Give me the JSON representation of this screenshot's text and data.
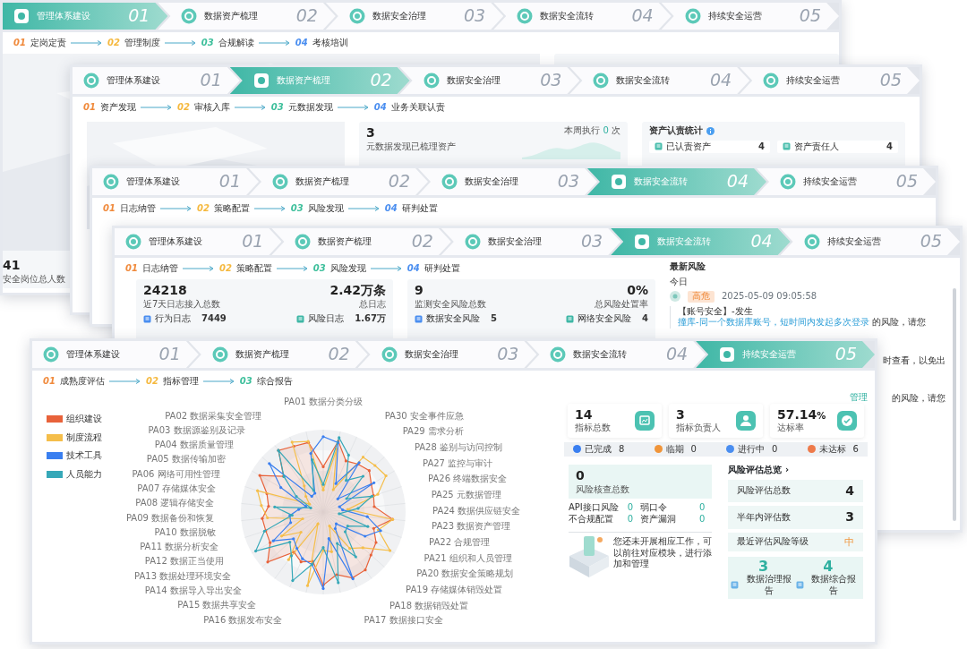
{
  "windows": [
    {
      "kind": "staff",
      "steps": [
        {
          "label": "管理体系建设",
          "number": "01",
          "selected": true
        },
        {
          "label": "数据资产梳理",
          "number": "02",
          "selected": false
        },
        {
          "label": "数据安全治理",
          "number": "03",
          "selected": false
        },
        {
          "label": "数据安全流转",
          "number": "04",
          "selected": false
        },
        {
          "label": "持续安全运营",
          "number": "05",
          "selected": false
        }
      ],
      "breadcrumb": [
        {
          "number": "01",
          "label": "定岗定责",
          "color": "#f08a3c"
        },
        {
          "number": "02",
          "label": "管理制度",
          "color": "#f5b83d"
        },
        {
          "number": "03",
          "label": "合规解读",
          "color": "#3dbf9b"
        },
        {
          "number": "04",
          "label": "考核培训",
          "color": "#4a8ef0"
        }
      ],
      "stat": {
        "value": "41",
        "label": "安全岗位总人数"
      }
    },
    {
      "kind": "assets",
      "steps": [
        {
          "label": "管理体系建设",
          "number": "01",
          "selected": false
        },
        {
          "label": "数据资产梳理",
          "number": "02",
          "selected": true
        },
        {
          "label": "数据安全治理",
          "number": "03",
          "selected": false
        },
        {
          "label": "数据安全流转",
          "number": "04",
          "selected": false
        },
        {
          "label": "持续安全运营",
          "number": "05",
          "selected": false
        }
      ],
      "breadcrumb": [
        {
          "number": "01",
          "label": "资产发现",
          "color": "#f08a3c"
        },
        {
          "number": "02",
          "label": "审核入库",
          "color": "#f5b83d"
        },
        {
          "number": "03",
          "label": "元数据发现",
          "color": "#3dbf9b"
        },
        {
          "number": "04",
          "label": "业务关联认责",
          "color": "#4a8ef0"
        }
      ],
      "discovery": {
        "value": "3",
        "label": "元数据发现已梳理资产",
        "run_label": "本周执行",
        "run_count": "0",
        "run_unit": "次"
      },
      "ownership": {
        "title": "资产认责统计",
        "items": [
          {
            "label": "已认责资产",
            "value": "4"
          },
          {
            "label": "资产责任人",
            "value": "4"
          }
        ]
      }
    },
    {
      "kind": "plain",
      "steps": [
        {
          "label": "管理体系建设",
          "number": "01",
          "selected": false
        },
        {
          "label": "数据资产梳理",
          "number": "02",
          "selected": false
        },
        {
          "label": "数据安全治理",
          "number": "03",
          "selected": false
        },
        {
          "label": "数据安全流转",
          "number": "04",
          "selected": true
        },
        {
          "label": "持续安全运营",
          "number": "05",
          "selected": false
        }
      ],
      "breadcrumb": [
        {
          "number": "01",
          "label": "日志纳管",
          "color": "#f08a3c"
        },
        {
          "number": "02",
          "label": "策略配置",
          "color": "#f5b83d"
        },
        {
          "number": "03",
          "label": "风险发现",
          "color": "#3dbf9b"
        },
        {
          "number": "04",
          "label": "研判处置",
          "color": "#4a8ef0"
        }
      ]
    },
    {
      "kind": "risk",
      "steps": [
        {
          "label": "管理体系建设",
          "number": "01",
          "selected": false
        },
        {
          "label": "数据资产梳理",
          "number": "02",
          "selected": false
        },
        {
          "label": "数据安全治理",
          "number": "03",
          "selected": false
        },
        {
          "label": "数据安全流转",
          "number": "04",
          "selected": true
        },
        {
          "label": "持续安全运营",
          "number": "05",
          "selected": false
        }
      ],
      "breadcrumb": [
        {
          "number": "01",
          "label": "日志纳管",
          "color": "#f08a3c"
        },
        {
          "number": "02",
          "label": "策略配置",
          "color": "#f5b83d"
        },
        {
          "number": "03",
          "label": "风险发现",
          "color": "#3dbf9b"
        },
        {
          "number": "04",
          "label": "研判处置",
          "color": "#4a8ef0"
        }
      ],
      "cards": [
        {
          "value": "24218",
          "label": "近7天日志接入总数",
          "value2": "2.42万条",
          "label2": "总日志",
          "items": [
            {
              "label": "行为日志",
              "value": "7449"
            },
            {
              "label": "风险日志",
              "value": "1.67万"
            }
          ]
        },
        {
          "value": "9",
          "label": "监测安全风险总数",
          "value2": "0%",
          "label2": "总风险处置率",
          "items": [
            {
              "label": "数据安全风险",
              "value": "5"
            },
            {
              "label": "网络安全风险",
              "value": "4"
            }
          ]
        }
      ],
      "latest": {
        "title": "最新风险",
        "day": "今日",
        "level": "高危",
        "time": "2025-05-09 09:05:58",
        "prefix": "【账号安全】-发生",
        "link": "撞库-同一个数据库账号，短时间内发起多次登录",
        "suffix": "的风险，请您",
        "fragments": [
          "时查看，以免出",
          "的风险，请您"
        ]
      }
    },
    {
      "kind": "ops",
      "steps": [
        {
          "label": "管理体系建设",
          "number": "01",
          "selected": false
        },
        {
          "label": "数据资产梳理",
          "number": "02",
          "selected": false
        },
        {
          "label": "数据安全治理",
          "number": "03",
          "selected": false
        },
        {
          "label": "数据安全流转",
          "number": "04",
          "selected": false
        },
        {
          "label": "持续安全运营",
          "number": "05",
          "selected": true
        }
      ],
      "breadcrumb": [
        {
          "number": "01",
          "label": "成熟度评估",
          "color": "#f08a3c"
        },
        {
          "number": "02",
          "label": "指标管理",
          "color": "#f5b83d"
        },
        {
          "number": "03",
          "label": "综合报告",
          "color": "#3dbf9b"
        }
      ],
      "legend": [
        {
          "label": "组织建设",
          "color": "#e8623a"
        },
        {
          "label": "制度流程",
          "color": "#f5be4a"
        },
        {
          "label": "技术工具",
          "color": "#3a7ff0"
        },
        {
          "label": "人员能力",
          "color": "#36a8b8"
        }
      ],
      "radar_labels": [
        "PA01 数据分类分级",
        "PA02 数据采集安全管理",
        "PA03 数据源鉴别及记录",
        "PA04 数据质量管理",
        "PA05 数据传输加密",
        "PA06 网络可用性管理",
        "PA07 存储媒体安全",
        "PA08 逻辑存储安全",
        "PA09 数据备份和恢复",
        "PA10 数据脱敏",
        "PA11 数据分析安全",
        "PA12 数据正当使用",
        "PA13 数据处理环境安全",
        "PA14 数据导入导出安全",
        "PA15 数据共享安全",
        "PA16 数据发布安全"
      ],
      "radar_labels_right": [
        "PA30 安全事件应急",
        "PA29 需求分析",
        "PA28 鉴别与访问控制",
        "PA27 监控与审计",
        "PA26 终端数据安全",
        "PA25 元数据管理",
        "PA24 数据供应链安全",
        "PA23 数据资产管理",
        "PA22 合规管理",
        "PA21 组织和人员管理",
        "PA20 数据安全策略规划",
        "PA19 存储媒体销毁处置",
        "PA18 数据销毁处置",
        "PA17 数据接口安全"
      ],
      "manage_link": "管理",
      "stats": [
        {
          "value": "14",
          "label": "指标总数"
        },
        {
          "value": "3",
          "label": "指标负责人"
        },
        {
          "value": "57.14",
          "unit": "%",
          "label": "达标率"
        }
      ],
      "statuses": [
        {
          "label": "已完成",
          "count": "8",
          "color": "#3a7ff0"
        },
        {
          "label": "临期",
          "count": "0",
          "color": "#f0953a"
        },
        {
          "label": "进行中",
          "count": "0",
          "color": "#4a8ef0"
        },
        {
          "label": "未达标",
          "count": "6",
          "color": "#ee7a4a"
        }
      ],
      "check": {
        "value": "0",
        "label": "风险核查总数",
        "items": [
          {
            "label": "API接口风险",
            "value": "0"
          },
          {
            "label": "弱口令",
            "value": "0"
          },
          {
            "label": "不合规配置",
            "value": "0"
          },
          {
            "label": "资产漏洞",
            "value": "0"
          }
        ],
        "empty_text": "您还未开展相应工作，可以前往对应模块，进行添加和管理"
      },
      "assessment": {
        "title": "风险评估总览 ›",
        "rows": [
          {
            "label": "风险评估总数",
            "value": "4",
            "kind": "number"
          },
          {
            "label": "半年内评估数",
            "value": "3",
            "kind": "number"
          },
          {
            "label": "最近评估风险等级",
            "value": "中",
            "kind": "level"
          }
        ]
      },
      "reports": [
        {
          "value": "3",
          "label": "数据治理报告"
        },
        {
          "value": "4",
          "label": "数据综合报告"
        }
      ]
    }
  ]
}
